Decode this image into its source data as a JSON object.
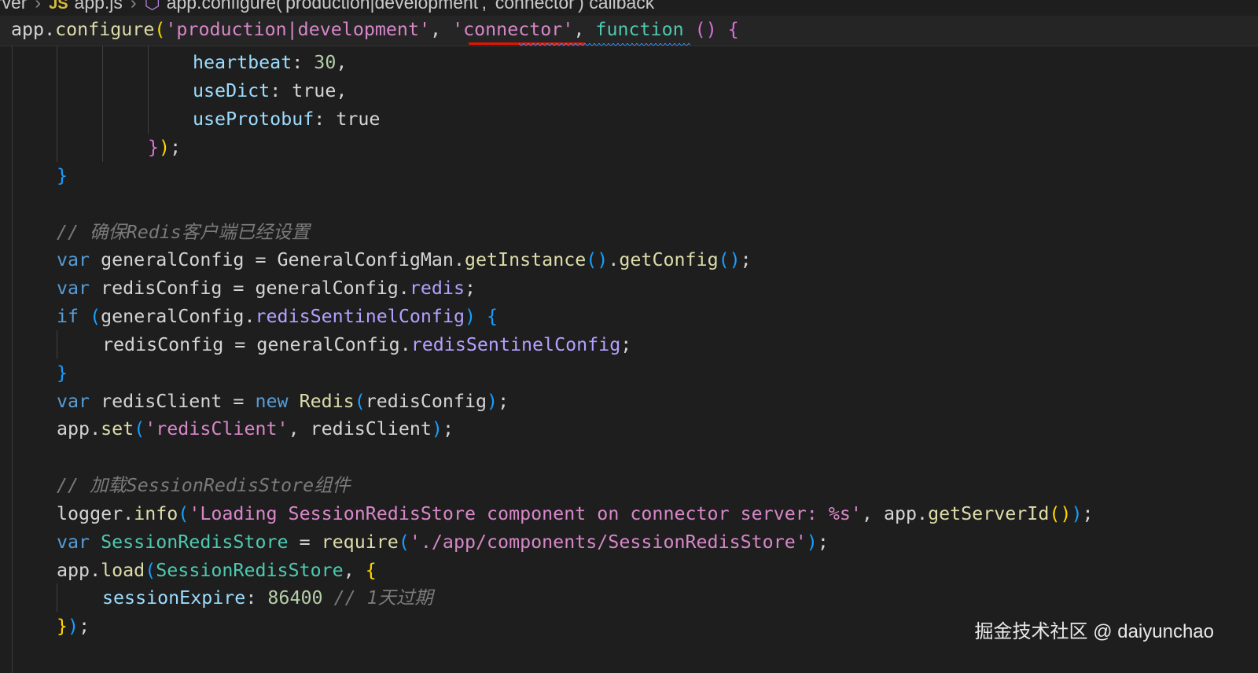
{
  "breadcrumb": {
    "segments": [
      "erver",
      "app.js",
      "app.configure('production|development', 'connector') callback"
    ],
    "js_icon_text": "JS",
    "separator": "›"
  },
  "sticky_line": {
    "obj": "app",
    "dot": ".",
    "method": "configure",
    "paren_open": "(",
    "arg1": "'production|development'",
    "comma1": ", ",
    "arg2": "'connector'",
    "comma2": ", ",
    "fn_kw": "function",
    "fn_parens": " ()",
    "brace": " {"
  },
  "code": {
    "l1": {
      "prop": "heartbeat",
      "colon": ": ",
      "num": "30",
      "tail": ","
    },
    "l2": {
      "prop": "useDict",
      "colon": ": ",
      "val": "true",
      "tail": ","
    },
    "l3": {
      "prop": "useProtobuf",
      "colon": ": ",
      "val": "true"
    },
    "l4": {
      "brace": "}",
      "paren": ")",
      "semi": ";"
    },
    "l5": {
      "brace": "}"
    },
    "l7": {
      "comment": "// 确保Redis客户端已经设置"
    },
    "l8": {
      "kw": "var",
      "name": " generalConfig = ",
      "cls": "GeneralConfigMan",
      "dot": ".",
      "fn1": "getInstance",
      "p1": "()",
      "dot2": ".",
      "fn2": "getConfig",
      "p2": "()",
      "semi": ";"
    },
    "l9": {
      "kw": "var",
      "name": " redisConfig = generalConfig.",
      "prop": "redis",
      "semi": ";"
    },
    "l10": {
      "kw": "if",
      "open": " (",
      "obj": "generalConfig.",
      "prop": "redisSentinelConfig",
      "close": ")",
      "brace": " {"
    },
    "l11": {
      "name": "redisConfig = generalConfig.",
      "prop": "redisSentinelConfig",
      "semi": ";"
    },
    "l12": {
      "brace": "}"
    },
    "l13": {
      "kw": "var",
      "name": " redisClient = ",
      "kw2": "new",
      "cls": " Redis",
      "open": "(",
      "arg": "redisConfig",
      "close": ")",
      "semi": ";"
    },
    "l14": {
      "obj": "app.",
      "fn": "set",
      "open": "(",
      "str": "'redisClient'",
      "mid": ", redisClient",
      "close": ")",
      "semi": ";"
    },
    "l16": {
      "comment": "// 加载SessionRedisStore组件"
    },
    "l17": {
      "obj": "logger.",
      "fn": "info",
      "open": "(",
      "str": "'Loading SessionRedisStore component on connector server: %s'",
      "mid": ", app.",
      "fn2": "getServerId",
      "p2": "()",
      "close": ")",
      "semi": ";"
    },
    "l18": {
      "kw": "var",
      "cls": " SessionRedisStore",
      "eq": " = ",
      "fn": "require",
      "open": "(",
      "str": "'./app/components/SessionRedisStore'",
      "close": ")",
      "semi": ";"
    },
    "l19": {
      "obj": "app.",
      "fn": "load",
      "open": "(",
      "arg": "SessionRedisStore",
      "comma": ", ",
      "brace": "{"
    },
    "l20": {
      "prop": "sessionExpire",
      "colon": ": ",
      "num": "86400",
      "comment": " // 1天过期"
    },
    "l21": {
      "brace": "}",
      "close": ")",
      "semi": ";"
    }
  },
  "watermark": "掘金技术社区 @ daiyunchao"
}
